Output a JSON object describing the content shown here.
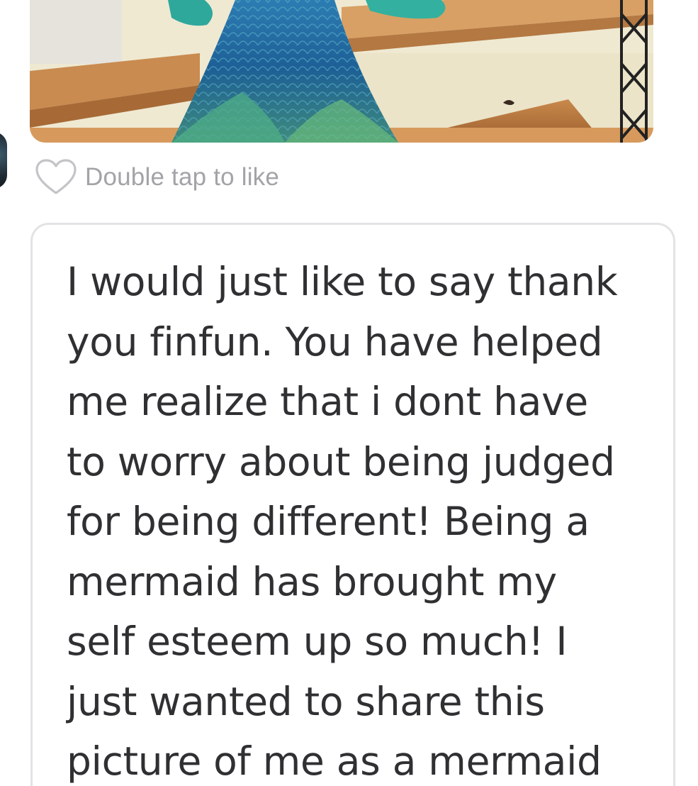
{
  "attachment": {
    "kind": "photo",
    "subject": "mermaid tail costume"
  },
  "like": {
    "icon": "heart-outline-icon",
    "label": "Double tap to like"
  },
  "message": {
    "lines": [
      "I would just like to say thank",
      "you finfun. You have helped",
      "me realize that i dont have",
      "to worry about being judged",
      "for being different! Being a",
      "mermaid has brought my",
      "self esteem up so much! I",
      "just wanted to share this",
      "picture of me as a mermaid"
    ]
  },
  "colors": {
    "like_text": "#a3a3a8",
    "message_text": "#303033",
    "bubble_border": "#e3e3e6"
  }
}
